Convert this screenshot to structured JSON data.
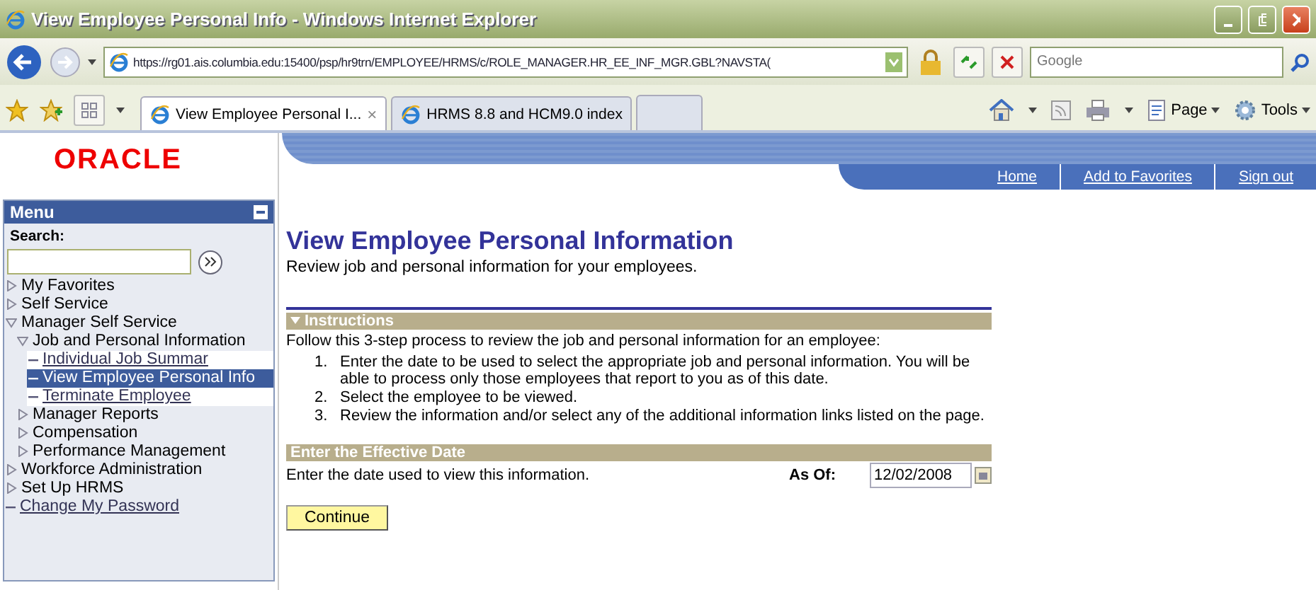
{
  "window": {
    "title": "View Employee Personal Info - Windows Internet Explorer"
  },
  "address_bar": {
    "url": "https://rg01.ais.columbia.edu:15400/psp/hr9trn/EMPLOYEE/HRMS/c/ROLE_MANAGER.HR_EE_INF_MGR.GBL?NAVSTA(",
    "search_placeholder": "Google"
  },
  "tabs": [
    {
      "label": "View Employee Personal I...",
      "selected": true,
      "close": "×"
    },
    {
      "label": "HRMS 8.8 and HCM9.0 index",
      "selected": false
    }
  ],
  "command_bar": [
    {
      "label": "Page"
    },
    {
      "label": "Tools"
    }
  ],
  "logo": "ORACLE",
  "header_links": [
    "Home",
    "Add to Favorites",
    "Sign out"
  ],
  "menu": {
    "title": "Menu",
    "search_label": "Search:",
    "items": [
      {
        "label": "My Favorites",
        "kind": "folder",
        "expanded": false,
        "selected": false
      },
      {
        "label": "Self Service",
        "kind": "folder",
        "expanded": false,
        "selected": false
      },
      {
        "label": "Manager Self Service",
        "kind": "folder",
        "expanded": true,
        "selected": false,
        "children": [
          {
            "label": "Job and Personal Information",
            "kind": "folder",
            "expanded": true,
            "selected": false,
            "children": [
              {
                "label": "Individual Job Summar",
                "kind": "link",
                "selected": false
              },
              {
                "label": "View Employee Personal Info",
                "kind": "link",
                "selected": true
              },
              {
                "label": "Terminate Employee",
                "kind": "link",
                "selected": false
              }
            ]
          },
          {
            "label": "Manager Reports",
            "kind": "folder",
            "expanded": false,
            "selected": false
          },
          {
            "label": "Compensation",
            "kind": "folder",
            "expanded": false,
            "selected": false
          },
          {
            "label": "Performance Management",
            "kind": "folder",
            "expanded": false,
            "selected": false
          }
        ]
      },
      {
        "label": "Workforce Administration",
        "kind": "folder",
        "expanded": false,
        "selected": false
      },
      {
        "label": "Set Up HRMS",
        "kind": "folder",
        "expanded": false,
        "selected": false
      },
      {
        "label": "Change My Password",
        "kind": "link",
        "selected": false
      }
    ]
  },
  "page": {
    "title": "View Employee Personal Information",
    "subtitle": "Review job and personal information for your employees.",
    "instructions": {
      "header": "Instructions",
      "expanded": true,
      "intro": "Follow this 3-step process to review the job and personal information for an employee:",
      "steps": [
        {
          "number": "1.",
          "text": "Enter the date to be used to select the appropriate job and personal information. You will be able to process only those employees that report to you as of this date."
        },
        {
          "number": "2.",
          "text": "Select the employee to be viewed."
        },
        {
          "number": "3.",
          "text": "Review the information and/or select any of the additional information links listed on the page."
        }
      ]
    },
    "effective_date": {
      "header": "Enter the Effective Date",
      "description": "Enter the date used to view this information.",
      "label": "As Of:",
      "value": "12/02/2008"
    },
    "continue_button": "Continue"
  }
}
